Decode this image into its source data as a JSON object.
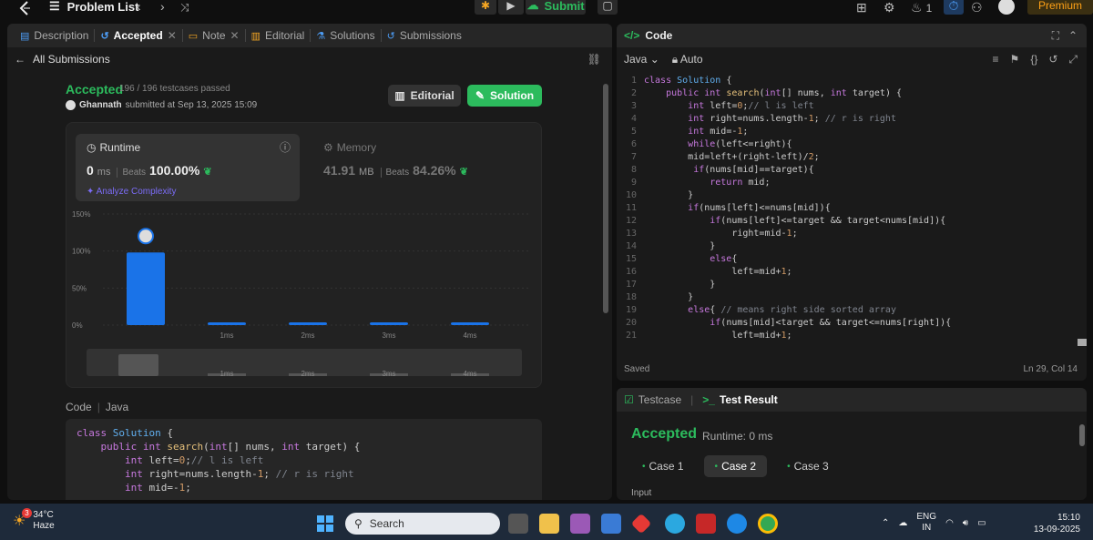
{
  "topbar": {
    "problem_list": "Problem List",
    "submit_label": "Submit",
    "streak_count": "1",
    "premium_label": "Premium"
  },
  "left_tabs": [
    {
      "label": "Description",
      "icon": "description-icon"
    },
    {
      "label": "Accepted",
      "icon": "history-icon",
      "active": true
    },
    {
      "label": "Note",
      "icon": "note-icon"
    },
    {
      "label": "Editorial",
      "icon": "book-icon"
    },
    {
      "label": "Solutions",
      "icon": "flask-icon"
    },
    {
      "label": "Submissions",
      "icon": "history-icon"
    }
  ],
  "submission": {
    "back_label": "All Submissions",
    "status": "Accepted",
    "testcases": "196 / 196 testcases passed",
    "user": "Ghannath",
    "submitted_text": "submitted at Sep 13, 2025 15:09",
    "editorial_btn": "Editorial",
    "solution_btn": "Solution"
  },
  "stats": {
    "runtime_label": "Runtime",
    "runtime_value": "0",
    "runtime_unit": "ms",
    "runtime_beats_label": "Beats",
    "runtime_beats": "100.00%",
    "analyze": "Analyze Complexity",
    "memory_label": "Memory",
    "memory_value": "41.91",
    "memory_unit": "MB",
    "memory_beats_label": "Beats",
    "memory_beats": "84.26%"
  },
  "chart_data": {
    "type": "bar",
    "categories": [
      "",
      "1ms",
      "2ms",
      "3ms",
      "4ms"
    ],
    "values": [
      98,
      3,
      3,
      3,
      3
    ],
    "ylim": [
      0,
      150
    ],
    "yticks": [
      "0%",
      "50%",
      "100%",
      "150%"
    ],
    "highlight_index": 0,
    "overview_labels": [
      "1ms",
      "2ms",
      "3ms",
      "4ms"
    ]
  },
  "code_preview": {
    "header_code": "Code",
    "header_lang": "Java"
  },
  "code_panel": {
    "title": "Code",
    "language": "Java",
    "mode": "Auto",
    "status": "Saved",
    "cursor": "Ln 29, Col 14"
  },
  "result_panel": {
    "testcase_tab": "Testcase",
    "result_tab": "Test Result",
    "status": "Accepted",
    "runtime": "Runtime: 0 ms",
    "cases": [
      "Case 1",
      "Case 2",
      "Case 3"
    ],
    "active_case": 1,
    "input_label": "Input"
  },
  "taskbar": {
    "temperature": "34°C",
    "weather": "Haze",
    "weather_badge": "3",
    "search_placeholder": "Search",
    "lang_line1": "ENG",
    "lang_line2": "IN",
    "time": "15:10",
    "date": "13-09-2025"
  },
  "colors": {
    "accent_green": "#2cbb5d",
    "bar_blue": "#1a73e8",
    "premium_orange": "#ffa116",
    "analyze_purple": "#7b6cf6"
  }
}
